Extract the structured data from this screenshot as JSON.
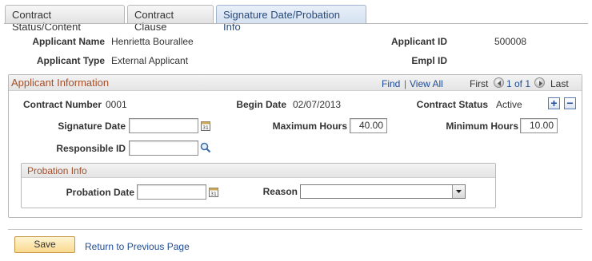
{
  "tabs": [
    {
      "label": "Contract Status/Content"
    },
    {
      "label": "Contract Clause"
    },
    {
      "label": "Signature Date/Probation Info"
    }
  ],
  "header": {
    "applicant_name_label": "Applicant Name",
    "applicant_name_value": "Henrietta Bourallee",
    "applicant_type_label": "Applicant Type",
    "applicant_type_value": "External Applicant",
    "applicant_id_label": "Applicant ID",
    "applicant_id_value": "500008",
    "empl_id_label": "Empl ID"
  },
  "group": {
    "title": "Applicant Information",
    "find": "Find",
    "sep": "|",
    "view_all": "View All",
    "first": "First",
    "page_status": "1 of 1",
    "last": "Last"
  },
  "contract": {
    "number_label": "Contract Number",
    "number_value": "0001",
    "begin_date_label": "Begin Date",
    "begin_date_value": "02/07/2013",
    "status_label": "Contract Status",
    "status_value": "Active",
    "add_symbol": "+",
    "remove_symbol": "−"
  },
  "fields": {
    "signature_date_label": "Signature Date",
    "signature_date_value": "",
    "max_hours_label": "Maximum Hours",
    "max_hours_value": "40.00",
    "min_hours_label": "Minimum Hours",
    "min_hours_value": "10.00",
    "responsible_id_label": "Responsible ID",
    "responsible_id_value": ""
  },
  "probation": {
    "title": "Probation Info",
    "date_label": "Probation Date",
    "date_value": "",
    "reason_label": "Reason",
    "reason_value": ""
  },
  "footer": {
    "save_label": "Save",
    "return_label": "Return to Previous Page"
  },
  "icons": {
    "calendar": "calendar-icon",
    "search": "search-icon",
    "dropdown": "chevron-down-icon"
  },
  "colors": {
    "group_title": "#a4502a",
    "link": "#1f4c94",
    "save_button": "#f9d98f",
    "active_tab": "#d4e1f1"
  }
}
